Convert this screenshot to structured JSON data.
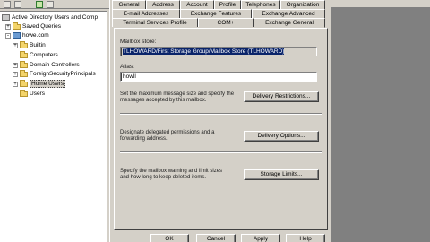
{
  "toolbar": {
    "icons": [
      "back-icon",
      "forward-icon",
      "up-icon",
      "refresh-icon"
    ]
  },
  "tree": {
    "root_label": "Active Directory Users and Comp",
    "items": [
      {
        "label": "Saved Queries",
        "icon": "folder-icon",
        "expander": "+"
      },
      {
        "label": "howe.com",
        "icon": "domain-icon",
        "expander": "-"
      },
      {
        "label": "Builtin",
        "icon": "folder-icon",
        "expander": "+"
      },
      {
        "label": "Computers",
        "icon": "folder-icon",
        "expander": ""
      },
      {
        "label": "Domain Controllers",
        "icon": "folder-icon",
        "expander": "+"
      },
      {
        "label": "ForeignSecurityPrincipals",
        "icon": "folder-icon",
        "expander": "+"
      },
      {
        "label": "Home Users",
        "icon": "folder-icon",
        "expander": "+"
      },
      {
        "label": "Users",
        "icon": "folder-icon",
        "expander": ""
      }
    ]
  },
  "tabs": {
    "row1": [
      "General",
      "Address",
      "Account",
      "Profile",
      "Telephones",
      "Organization"
    ],
    "row2": [
      "E-mail Addresses",
      "Exchange Features",
      "Exchange Advanced"
    ],
    "row3": [
      "Terminal Services Profile",
      "COM+",
      "Exchange General"
    ]
  },
  "mailbox_store": {
    "label": "Mailbox store:",
    "value": "TLHOWARD/First Storage Group/Mailbox Store (TLHOWARD)"
  },
  "alias": {
    "label": "Alias:",
    "value": "howll"
  },
  "sections": [
    {
      "text": "Set the maximum message size and specify the messages accepted by this mailbox.",
      "button": "Delivery Restrictions...",
      "underline": "D"
    },
    {
      "text": "Designate delegated permissions and a forwarding address.",
      "button": "Delivery Options...",
      "underline": "e"
    },
    {
      "text": "Specify the mailbox warning and limit sizes and how long to keep deleted items.",
      "button": "Storage Limits...",
      "underline": "S"
    }
  ],
  "footer": {
    "ok": "OK",
    "cancel": "Cancel",
    "apply": "Apply",
    "help": "Help"
  }
}
